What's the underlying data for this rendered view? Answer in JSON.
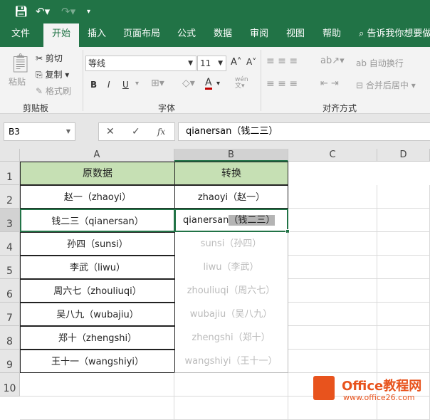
{
  "qat": {
    "save_icon": "save-icon",
    "undo_icon": "undo-icon",
    "redo_icon": "redo-icon",
    "customize_icon": "customize-icon"
  },
  "tabs": [
    "文件",
    "开始",
    "插入",
    "页面布局",
    "公式",
    "数据",
    "审阅",
    "视图",
    "帮助"
  ],
  "active_tab": "开始",
  "search": {
    "placeholder": "告诉我你想要做"
  },
  "ribbon": {
    "clipboard": {
      "paste": "粘贴",
      "cut": "剪切",
      "copy": "复制",
      "format_painter": "格式刷",
      "group": "剪贴板"
    },
    "font": {
      "name": "等线",
      "size": "11",
      "bold": "B",
      "italic": "I",
      "underline": "U",
      "group": "字体",
      "font_color": "#c00000"
    },
    "alignment": {
      "wrap": "自动换行",
      "merge": "合并后居中",
      "group": "对齐方式"
    }
  },
  "formula_bar": {
    "name_box": "B3",
    "value": "qianersan（钱二三）",
    "cancel": "✕",
    "enter": "✓",
    "fx": "fx"
  },
  "columns": [
    "A",
    "B",
    "C",
    "D"
  ],
  "rows": [
    "1",
    "2",
    "3",
    "4",
    "5",
    "6",
    "7",
    "8",
    "9",
    "10"
  ],
  "table": {
    "headers": [
      "原数据",
      "转换"
    ],
    "colA": [
      "赵一（zhaoyi）",
      "钱二三（qianersan）",
      "孙四（sunsi）",
      "李武（liwu）",
      "周六七（zhouliuqi）",
      "吴八九（wubajiu）",
      "郑十（zhengshi）",
      "王十一（wangshiyi）"
    ],
    "colB": [
      "zhaoyi（赵一）",
      "qianersan",
      "（钱二三）",
      "sunsi（孙四）",
      "liwu（李武）",
      "zhouliuqi（周六七）",
      "wubajiu（吴八九）",
      "zhengshi（郑十）",
      "wangshiyi（王十一）"
    ]
  },
  "header_color": "#c6e0b4",
  "accent": "#217346",
  "watermark": {
    "name": "Office教程网",
    "url": "www.office26.com"
  }
}
